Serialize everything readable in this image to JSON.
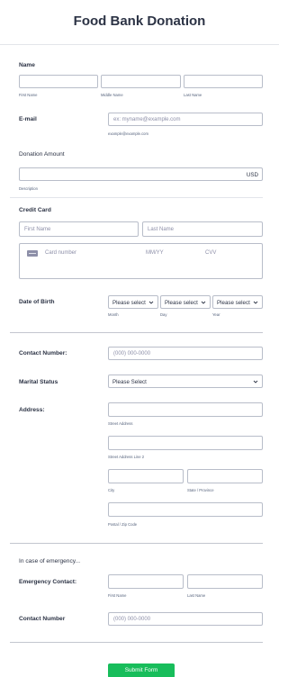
{
  "form": {
    "title": "Food Bank Donation",
    "name": {
      "label": "Name",
      "first_sub": "First Name",
      "middle_sub": "Middle Name",
      "last_sub": "Last Name"
    },
    "email": {
      "label": "E-mail",
      "placeholder": "ex: myname@example.com",
      "sub": "example@example.com"
    },
    "donation": {
      "label": "Donation Amount",
      "currency": "USD",
      "sub": "Description"
    },
    "credit_card": {
      "label": "Credit Card",
      "first_placeholder": "First Name",
      "last_placeholder": "Last Name",
      "card_number": "Card number",
      "expiry": "MM/YY",
      "cvv": "CVV"
    },
    "dob": {
      "label": "Date of Birth",
      "month_value": "Please select",
      "day_value": "Please select",
      "year_value": "Please select",
      "month_sub": "Month",
      "day_sub": "Day",
      "year_sub": "Year"
    },
    "contact": {
      "label": "Contact Number:",
      "placeholder": "(000) 000-0000"
    },
    "marital": {
      "label": "Marital Status",
      "value": "Please Select"
    },
    "address": {
      "label": "Address:",
      "street_sub": "Street Address",
      "street2_sub": "Street Address Line 2",
      "city_sub": "City",
      "state_sub": "State / Province",
      "zip_sub": "Postal / Zip Code"
    },
    "emergency": {
      "heading": "In case of emergency...",
      "contact_label": "Emergency Contact:",
      "first_sub": "First Name",
      "last_sub": "Last Name",
      "number_label": "Contact Number",
      "number_placeholder": "(000) 000-0000"
    },
    "submit_label": "Submit Form"
  },
  "icons": {
    "chevron": "chevron-down-icon",
    "card": "credit-card-icon"
  },
  "colors": {
    "submit": "#18bd5b",
    "text": "#2c3345",
    "border": "#b8bdc9"
  }
}
